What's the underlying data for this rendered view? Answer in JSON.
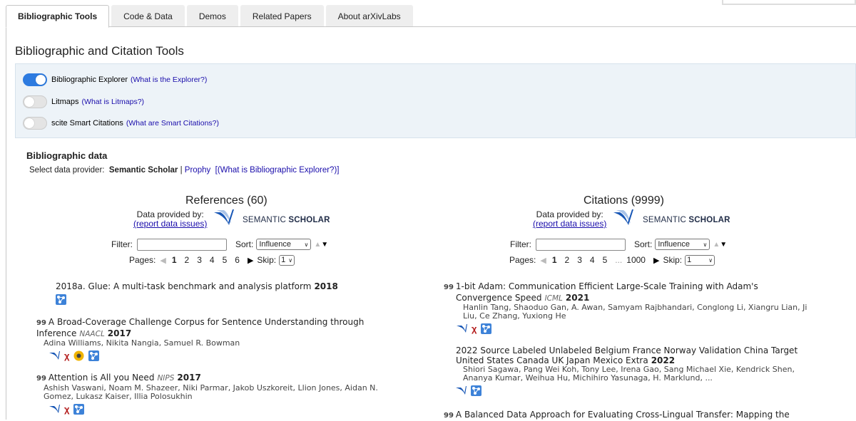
{
  "tabs": [
    {
      "label": "Bibliographic Tools",
      "active": true
    },
    {
      "label": "Code & Data",
      "active": false
    },
    {
      "label": "Demos",
      "active": false
    },
    {
      "label": "Related Papers",
      "active": false
    },
    {
      "label": "About arXivLabs",
      "active": false
    }
  ],
  "section_title": "Bibliographic and Citation Tools",
  "toggles": [
    {
      "label": "Bibliographic Explorer",
      "link": "(What is the Explorer?)",
      "on": true
    },
    {
      "label": "Litmaps",
      "link": "(What is Litmaps?)",
      "on": false
    },
    {
      "label": "scite Smart Citations",
      "link": "(What are Smart Citations?)",
      "on": false
    }
  ],
  "bib": {
    "heading": "Bibliographic data",
    "provider_prefix": "Select data provider:",
    "provider_selected": "Semantic Scholar",
    "provider_sep": "|",
    "provider_other": "Prophy",
    "help_link": "[(What is Bibliographic Explorer?)]"
  },
  "references": {
    "title": "References (60)",
    "provided_by": "Data provided by:",
    "report_link": "(report data issues)",
    "ss_brand_light": "SEMANTIC ",
    "ss_brand_bold": "SCHOLAR",
    "filter_label": "Filter:",
    "sort_label": "Sort:",
    "sort_value": "Influence",
    "pages_label": "Pages:",
    "pages": [
      "1",
      "2",
      "3",
      "4",
      "5",
      "6"
    ],
    "skip_label": "Skip:",
    "skip_value": "1",
    "papers": [
      {
        "title": "2018a. Glue: A multi-task benchmark and analysis platform",
        "venue": "",
        "year": "2018",
        "authors": ""
      },
      {
        "title": "A Broad-Coverage Challenge Corpus for Sentence Understanding through Inference",
        "venue": "NAACL",
        "year": "2017",
        "authors": "Adina Williams, Nikita Nangia, Samuel R. Bowman"
      },
      {
        "title": "Attention is All you Need",
        "venue": "NIPS",
        "year": "2017",
        "authors": "Ashish Vaswani, Noam M. Shazeer, Niki Parmar, Jakob Uszkoreit, Llion Jones, Aidan N. Gomez, Lukasz Kaiser, Illia Polosukhin"
      }
    ]
  },
  "citations": {
    "title": "Citations (9999)",
    "provided_by": "Data provided by:",
    "report_link": "(report data issues)",
    "ss_brand_light": "SEMANTIC ",
    "ss_brand_bold": "SCHOLAR",
    "filter_label": "Filter:",
    "sort_label": "Sort:",
    "sort_value": "Influence",
    "pages_label": "Pages:",
    "pages": [
      "1",
      "2",
      "3",
      "4",
      "5"
    ],
    "ellipsis": "...",
    "last_page": "1000",
    "skip_label": "Skip:",
    "skip_value": "1",
    "papers": [
      {
        "title": "1-bit Adam: Communication Efficient Large-Scale Training with Adam's Convergence Speed",
        "venue": "ICML",
        "year": "2021",
        "authors": "Hanlin Tang, Shaoduo Gan, A. Awan, Samyam Rajbhandari, Conglong Li, Xiangru Lian, Ji Liu, Ce Zhang, Yuxiong He"
      },
      {
        "title": "2022 Source Labeled Unlabeled Belgium France Norway Validation China Target United States Canada UK Japan Mexico Extra",
        "venue": "",
        "year": "2022",
        "authors": "Shiori Sagawa, Pang Wei Koh, Tony Lee, Irena Gao, Sang Michael Xie, Kendrick Shen, Ananya Kumar, Weihua Hu, Michihiro Yasunaga, H. Marklund, ..."
      },
      {
        "title": "A Balanced Data Approach for Evaluating Cross-Lingual Transfer: Mapping the",
        "venue": "",
        "year": "",
        "authors": ""
      }
    ]
  },
  "colors": {
    "link": "#1a0dab",
    "toggle_on": "#2d7be0",
    "panel_bg": "#edf3f8"
  }
}
